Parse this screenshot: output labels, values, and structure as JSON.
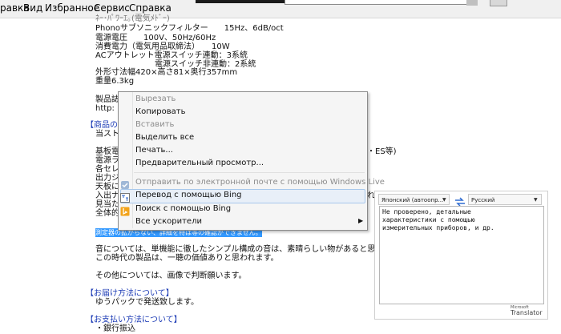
{
  "menubar": {
    "items": [
      "равка",
      "Вид",
      "Избранное",
      "Сервис",
      "Справка"
    ]
  },
  "page": {
    "spec_lines": [
      "Phonoサブソニックフィルター　　15Hz、6dB/oct",
      "電源電圧　　100V、50Hz/60Hz",
      "消費電力（電気用品取締法）　　10W",
      "ACアウトレット電源スイッチ連動：3系統",
      "電源スイッチ非連動：2系統",
      "外形寸法幅420×高さ81×奥行357mm",
      "重量6.3kg"
    ],
    "product_line1": "製品誌",
    "product_line2": "http:",
    "condition_header": "【商品の状",
    "condition_lines": [
      "当スト",
      "基板電",
      "電源ラ",
      "各セレ",
      "出力ジ",
      "天板に",
      "入出ナ",
      "見当た",
      "全体的"
    ],
    "right_fragment1": "・ES等)",
    "right_fragment2": "れ",
    "selected_text": "測定器の拡がらない、詳細を特は等の確認ができません。",
    "sound_line1": "音については、単機能に徹したシンプル構成の音は、素晴らしい物があると思われます。",
    "sound_line2": "この時代の製品は、一聴の価値ありと思われます。",
    "other_line": "その他については、画像で判断願います。",
    "delivery_header": "【お届け方法について】",
    "delivery_line": "ゆうパックで発送致します。",
    "payment_header": "【お支払い方法について】",
    "payment_line": "・銀行振込"
  },
  "context_menu": {
    "items": [
      {
        "label": "Вырезать",
        "enabled": false
      },
      {
        "label": "Копировать",
        "enabled": true
      },
      {
        "label": "Вставить",
        "enabled": false
      },
      {
        "label": "Выделить все",
        "enabled": true
      },
      {
        "label": "Печать...",
        "enabled": true
      },
      {
        "label": "Предварительный просмотр...",
        "enabled": true
      },
      {
        "label": "Отправить по электронной почте с помощью Windows Live",
        "enabled": false
      },
      {
        "label": "Перевод с помощью Bing",
        "enabled": true
      },
      {
        "label": "Поиск с помощью Bing",
        "enabled": true
      },
      {
        "label": "Все ускорители",
        "enabled": true
      }
    ],
    "hover_color": "#e8eff8"
  },
  "translator": {
    "source_lang": "Японский (автоопр...",
    "target_lang": "Русский",
    "result_lines": [
      "Не проверено, детальные",
      "характеристики с помощью",
      "измерительных приборов, и др."
    ],
    "brand_small": "Microsoft",
    "brand": "Translator"
  },
  "colors": {
    "selection": "#3399ff",
    "section_header": "#1c3bb5"
  }
}
